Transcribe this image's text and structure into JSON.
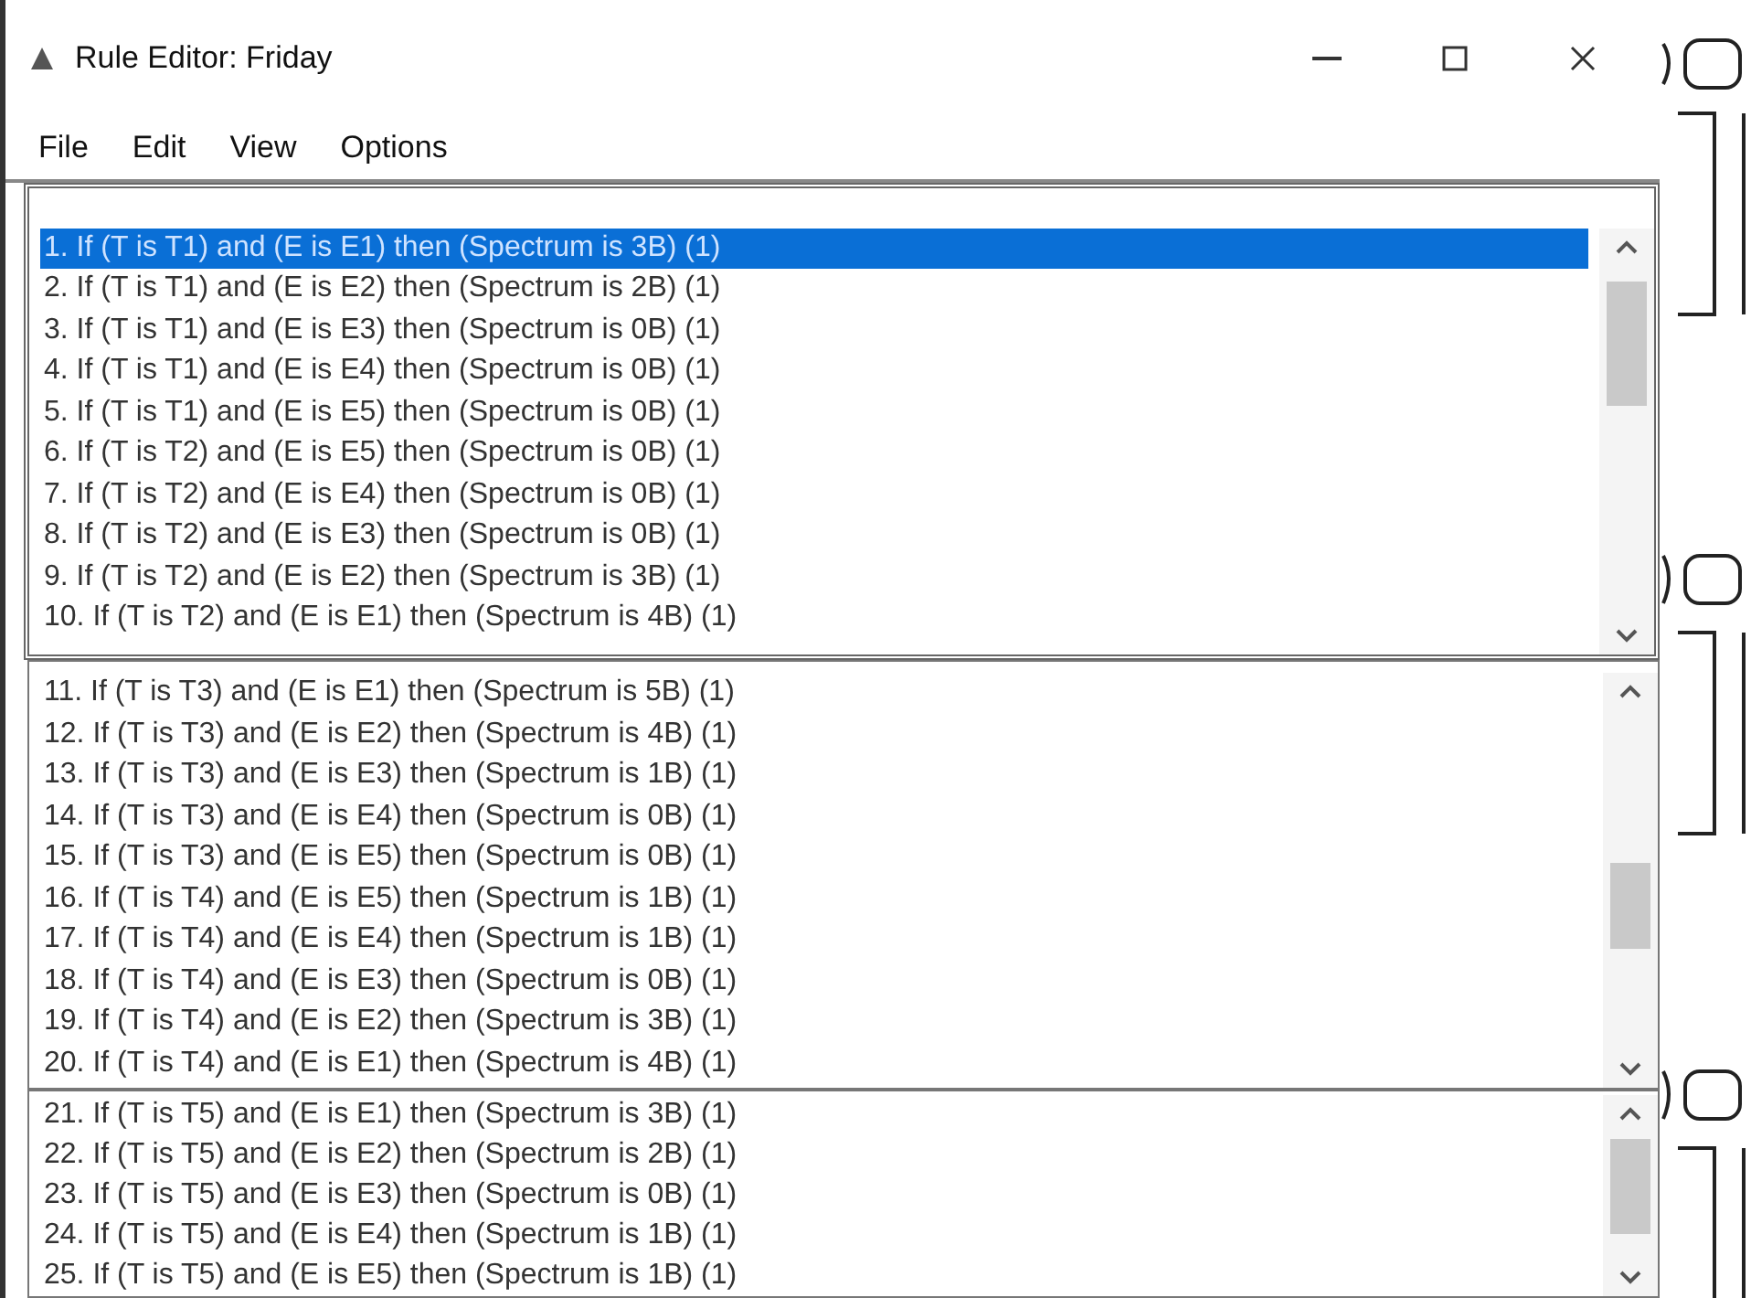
{
  "window": {
    "title": "Rule Editor: Friday"
  },
  "menu": [
    "File",
    "Edit",
    "View",
    "Options"
  ],
  "lists": [
    {
      "rules": [
        {
          "text": "1. If (T is T1) and (E is E1) then (Spectrum is 3B) (1)",
          "selected": true
        },
        {
          "text": "2. If (T is T1) and (E is E2) then (Spectrum is 2B) (1)",
          "selected": false
        },
        {
          "text": "3. If (T is T1) and (E is E3) then (Spectrum is 0B) (1)",
          "selected": false
        },
        {
          "text": "4. If (T is T1) and (E is E4) then (Spectrum is 0B) (1)",
          "selected": false
        },
        {
          "text": "5. If (T is T1) and (E is E5) then (Spectrum is 0B) (1)",
          "selected": false
        },
        {
          "text": "6. If (T is T2) and (E is E5) then (Spectrum is 0B) (1)",
          "selected": false
        },
        {
          "text": "7. If (T is T2) and (E is E4) then (Spectrum is 0B) (1)",
          "selected": false
        },
        {
          "text": "8. If (T is T2) and (E is E3) then (Spectrum is 0B) (1)",
          "selected": false
        },
        {
          "text": "9. If (T is T2) and (E is E2) then (Spectrum is 3B) (1)",
          "selected": false
        },
        {
          "text": "10. If (T is T2) and (E is E1) then (Spectrum is 4B) (1)",
          "selected": false
        }
      ]
    },
    {
      "rules": [
        {
          "text": "11. If (T is T3) and (E is E1) then (Spectrum is 5B) (1)",
          "selected": false
        },
        {
          "text": "12. If (T is T3) and (E is E2) then (Spectrum is 4B) (1)",
          "selected": false
        },
        {
          "text": "13. If (T is T3) and (E is E3) then (Spectrum is 1B) (1)",
          "selected": false
        },
        {
          "text": "14. If (T is T3) and (E is E4) then (Spectrum is 0B) (1)",
          "selected": false
        },
        {
          "text": "15. If (T is T3) and (E is E5) then (Spectrum is 0B) (1)",
          "selected": false
        },
        {
          "text": "16. If (T is T4) and (E is E5) then (Spectrum is 1B) (1)",
          "selected": false
        },
        {
          "text": "17. If (T is T4) and (E is E4) then (Spectrum is 1B) (1)",
          "selected": false
        },
        {
          "text": "18. If (T is T4) and (E is E3) then (Spectrum is 0B) (1)",
          "selected": false
        },
        {
          "text": "19. If (T is T4) and (E is E2) then (Spectrum is 3B) (1)",
          "selected": false
        },
        {
          "text": "20. If (T is T4) and (E is E1) then (Spectrum is 4B) (1)",
          "selected": false
        }
      ]
    },
    {
      "rules": [
        {
          "text": "21. If (T is T5) and (E is E1) then (Spectrum is 3B) (1)",
          "selected": false
        },
        {
          "text": "22. If (T is T5) and (E is E2) then (Spectrum is 2B) (1)",
          "selected": false
        },
        {
          "text": "23. If (T is T5) and (E is E3) then (Spectrum is 0B) (1)",
          "selected": false
        },
        {
          "text": "24. If (T is T5) and (E is E4) then (Spectrum is 1B) (1)",
          "selected": false
        },
        {
          "text": "25. If (T is T5) and (E is E5) then (Spectrum is 1B) (1)",
          "selected": false
        }
      ]
    }
  ]
}
